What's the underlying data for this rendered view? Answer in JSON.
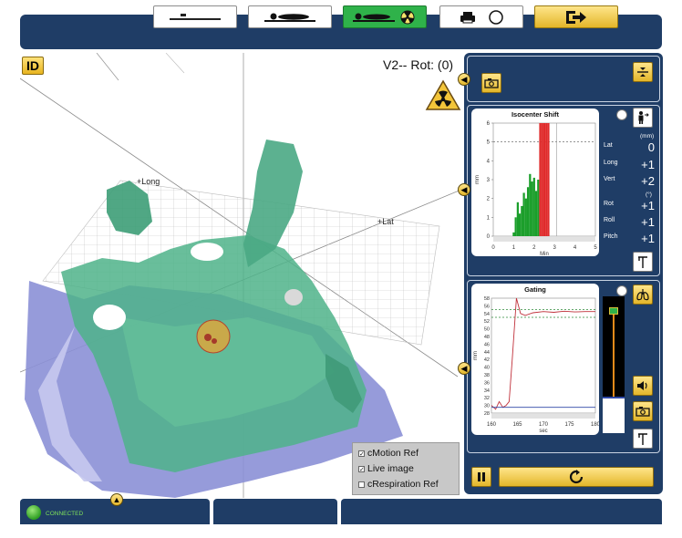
{
  "view": {
    "id_badge": "ID",
    "rotation_label": "V2-- Rot: (0)",
    "axis_long": "+Long",
    "axis_lat": "+Lat"
  },
  "toolbar": {
    "buttons": [
      {
        "icon": "couch-flat-icon"
      },
      {
        "icon": "patient-lying-icon"
      },
      {
        "icon": "patient-radiation-icon",
        "active": true
      },
      {
        "icon": "printer-icon"
      },
      {
        "icon": "exit-icon"
      }
    ]
  },
  "isocenter": {
    "title": "Isocenter Shift",
    "units_mm": "(mm)",
    "units_deg": "(°)",
    "labels": [
      "Lat",
      "Long",
      "Vert",
      "Rot",
      "Roll",
      "Pitch"
    ],
    "values": [
      "0",
      "+1",
      "+2",
      "+1",
      "+1",
      "+1"
    ]
  },
  "gating": {
    "title": "Gating"
  },
  "legend": {
    "items": [
      {
        "label": "cMotion Ref",
        "checked": true
      },
      {
        "label": "Live image",
        "checked": true
      },
      {
        "label": "cRespiration Ref",
        "checked": false
      }
    ]
  },
  "status": {
    "connected": "CONNECTED"
  },
  "colors": {
    "panel": "#1f3d66",
    "accent_gold": "#e3b62a",
    "active_green": "#2fb24a",
    "surface_green": "#4fb38a",
    "surface_blue": "#8a8fd8"
  },
  "chart_data": [
    {
      "type": "bar",
      "title": "Isocenter Shift",
      "xlabel": "Min",
      "ylabel": "mm",
      "xlim": [
        0,
        5
      ],
      "ylim": [
        0,
        6
      ],
      "xticks": [
        "0",
        "1",
        "2",
        "3",
        "4",
        "5"
      ],
      "yticks": [
        "0",
        "1",
        "2",
        "3",
        "4",
        "5",
        "6"
      ],
      "threshold": 5,
      "series": [
        {
          "color": "#1a9e2a",
          "x": [
            1.0,
            1.1,
            1.2,
            1.3,
            1.4,
            1.5,
            1.6,
            1.7,
            1.8,
            1.9,
            2.0,
            2.1,
            2.2
          ],
          "values": [
            0.2,
            1.0,
            1.8,
            1.2,
            1.6,
            2.3,
            2.0,
            2.6,
            3.3,
            2.9,
            3.1,
            2.4,
            3.0
          ]
        },
        {
          "color": "#e02b2b",
          "x": [
            2.3,
            2.4,
            2.5,
            2.6,
            2.7
          ],
          "values": [
            6,
            6,
            6,
            6,
            6
          ]
        }
      ]
    },
    {
      "type": "line",
      "title": "Gating",
      "xlabel": "sec",
      "ylabel": "mm",
      "xlim": [
        160,
        180
      ],
      "ylim": [
        28,
        58
      ],
      "xticks": [
        "160",
        "165",
        "170",
        "175",
        "180"
      ],
      "yticks": [
        "28",
        "30",
        "32",
        "34",
        "36",
        "38",
        "40",
        "42",
        "44",
        "46",
        "48",
        "50",
        "52",
        "54",
        "56",
        "58"
      ],
      "gate_upper": 55,
      "gate_lower": 53,
      "series": [
        {
          "color": "#c0303a",
          "x": [
            160,
            160.8,
            161.5,
            162.2,
            162.8,
            163.4,
            164,
            164.8,
            165.6,
            166.5,
            168,
            170,
            172,
            174,
            176,
            178,
            180
          ],
          "values": [
            30,
            29,
            31,
            29.5,
            30,
            31,
            42,
            58,
            54,
            53.5,
            54.2,
            54.5,
            54.3,
            54.6,
            54.4,
            54.5,
            54.5
          ]
        },
        {
          "color": "#2d47a6",
          "x": [
            160,
            180
          ],
          "values": [
            29.5,
            29.5
          ]
        }
      ]
    }
  ]
}
